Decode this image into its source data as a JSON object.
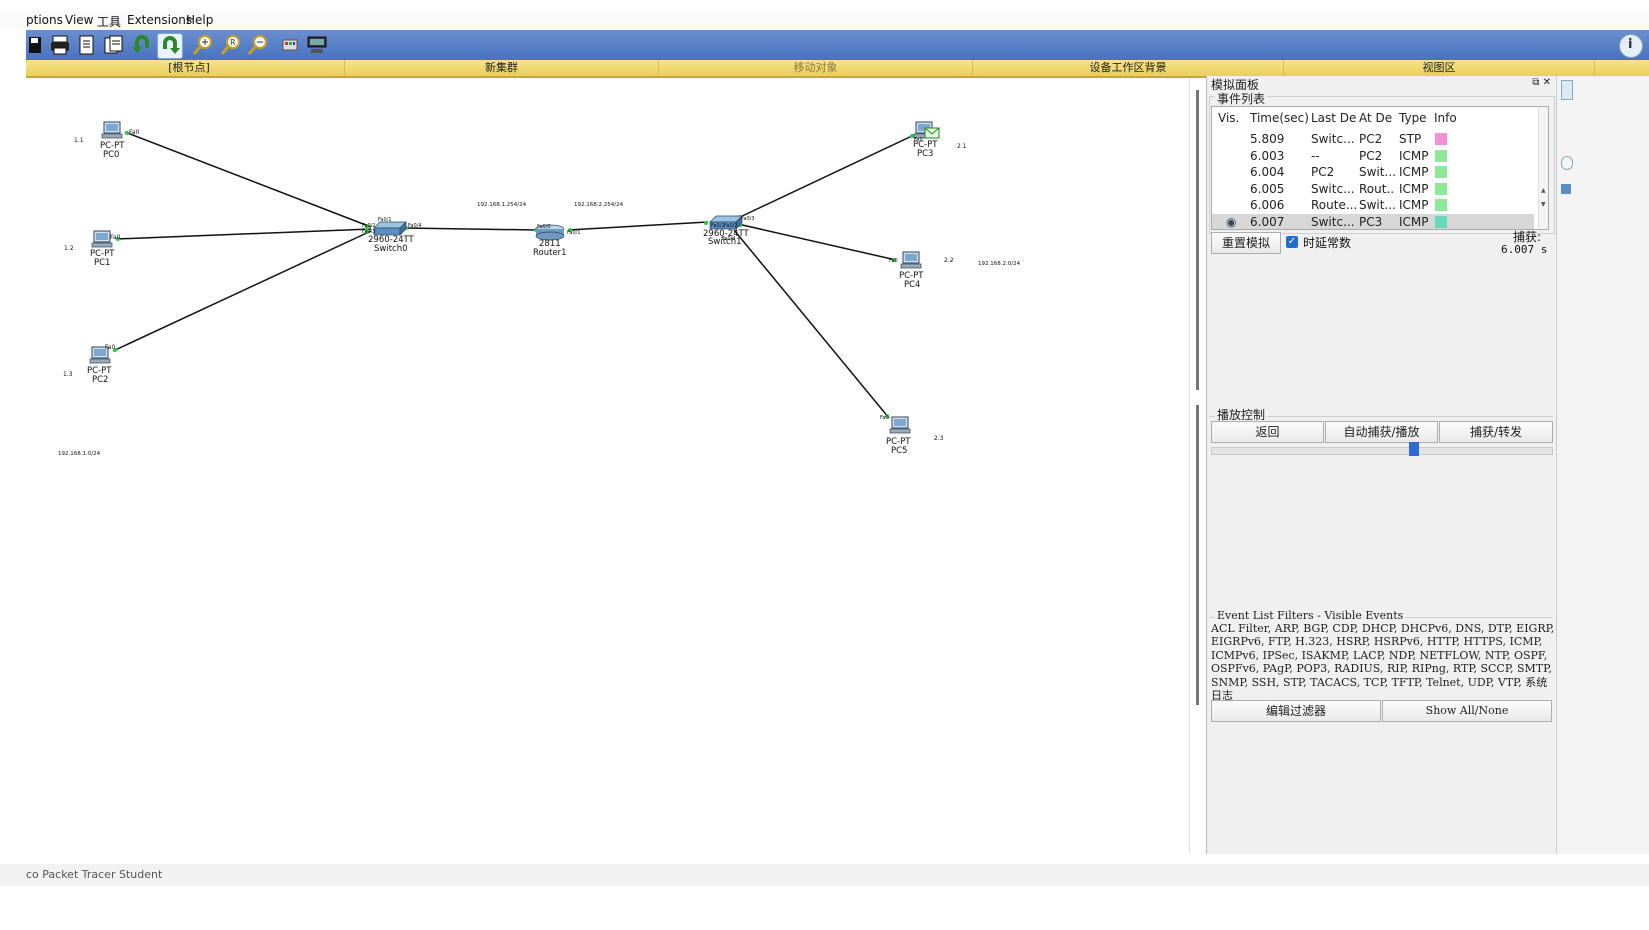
{
  "menu": {
    "items": [
      "ptions",
      "View",
      "工具",
      "Extensions",
      "Help"
    ]
  },
  "toolbar": {
    "icons": [
      "save-icon",
      "print-icon",
      "copy-icon",
      "paste-icon",
      "undo-icon",
      "redo-icon",
      "zoom-in-icon",
      "zoom-reset-icon",
      "zoom-out-icon",
      "palette-icon",
      "custom-device-icon"
    ],
    "info": "i"
  },
  "logical_bar": {
    "root": "[根节点]",
    "new_cluster": "新集群",
    "move_object": "移动对象",
    "set_background": "设备工作区背景",
    "viewport": "视图区"
  },
  "topology": {
    "devices": {
      "pc0": {
        "model": "PC-PT",
        "name": "PC0",
        "port": "Fa0",
        "ip": "1.1"
      },
      "pc1": {
        "model": "PC-PT",
        "name": "PC1",
        "port": "Fa0",
        "ip": "1.2"
      },
      "pc2": {
        "model": "PC-PT",
        "name": "PC2",
        "port": "Fa0",
        "ip": "1.3"
      },
      "switch0": {
        "model": "2960-24TT",
        "name": "Switch0",
        "ports": [
          "Fa0/1",
          "Fa0/2",
          "Fa0/3",
          "Fa0/4"
        ]
      },
      "router1": {
        "model": "2811",
        "name": "Router1",
        "ports": [
          "Fa0/0",
          "Fa0/1"
        ]
      },
      "switch1": {
        "model": "2960-24TT",
        "name": "Switch1",
        "ports": [
          "Fa0/1",
          "Fa0/2",
          "Fa0/3",
          "Fa0/4"
        ]
      },
      "pc3": {
        "model": "PC-PT",
        "name": "PC3",
        "port": "Fa0",
        "ip": "2.1"
      },
      "pc4": {
        "model": "PC-PT",
        "name": "PC4",
        "port": "Fa0",
        "ip": "2.2"
      },
      "pc5": {
        "model": "PC-PT",
        "name": "PC5",
        "port": "Fa0",
        "ip": "2.3"
      }
    },
    "labels": {
      "net1": "192.168.1.0/24",
      "gw1": "192.168.1.254/24",
      "gw2": "192.168.2.254/24",
      "net2": "192.168.2.0/24"
    }
  },
  "sim_panel": {
    "title": "模拟面板",
    "controls": "⧉ ✕",
    "event_list_label": "事件列表",
    "columns": [
      "Vis.",
      "Time(sec)",
      "Last De",
      "At De",
      "Type",
      "Info"
    ],
    "events": [
      {
        "time": "5.809",
        "last": "Switc...",
        "at": "PC2",
        "type": "STP",
        "color": "#f48fd8"
      },
      {
        "time": "6.003",
        "last": "--",
        "at": "PC2",
        "type": "ICMP",
        "color": "#8de89a"
      },
      {
        "time": "6.004",
        "last": "PC2",
        "at": "Swit...",
        "type": "ICMP",
        "color": "#8de89a"
      },
      {
        "time": "6.005",
        "last": "Switc...",
        "at": "Rout...",
        "type": "ICMP",
        "color": "#8de89a"
      },
      {
        "time": "6.006",
        "last": "Route...",
        "at": "Swit...",
        "type": "ICMP",
        "color": "#8de89a"
      },
      {
        "time": "6.007",
        "last": "Switc...",
        "at": "PC3",
        "type": "ICMP",
        "color": "#66d9b8"
      }
    ],
    "reset_button": "重置模拟",
    "constant_delay_label": "时延常数",
    "constant_delay_checked": true,
    "capture_label": "捕获:",
    "capture_value": "6.007 s",
    "playback_label": "播放控制",
    "back_button": "返回",
    "auto_capture_button": "自动捕获/播放",
    "capture_forward_button": "捕获/转发",
    "playback_speed": 0.6,
    "filters_label": "Event List Filters - Visible Events",
    "filters_text": "ACL Filter, ARP, BGP, CDP, DHCP, DHCPv6, DNS, DTP, EIGRP, EIGRPv6, FTP, H.323, HSRP, HSRPv6, HTTP, HTTPS, ICMP, ICMPv6, IPSec, ISAKMP, LACP, NDP, NETFLOW, NTP, OSPF, OSPFv6, PAgP, POP3, RADIUS, RIP, RIPng, RTP, SCCP, SMTP, SNMP, SSH, STP, TACACS, TCP, TFTP, Telnet, UDP, VTP, 系统日志",
    "edit_filters_button": "编辑过滤器",
    "show_all_button": "Show All/None"
  },
  "status": {
    "text": "co Packet Tracer Student"
  }
}
